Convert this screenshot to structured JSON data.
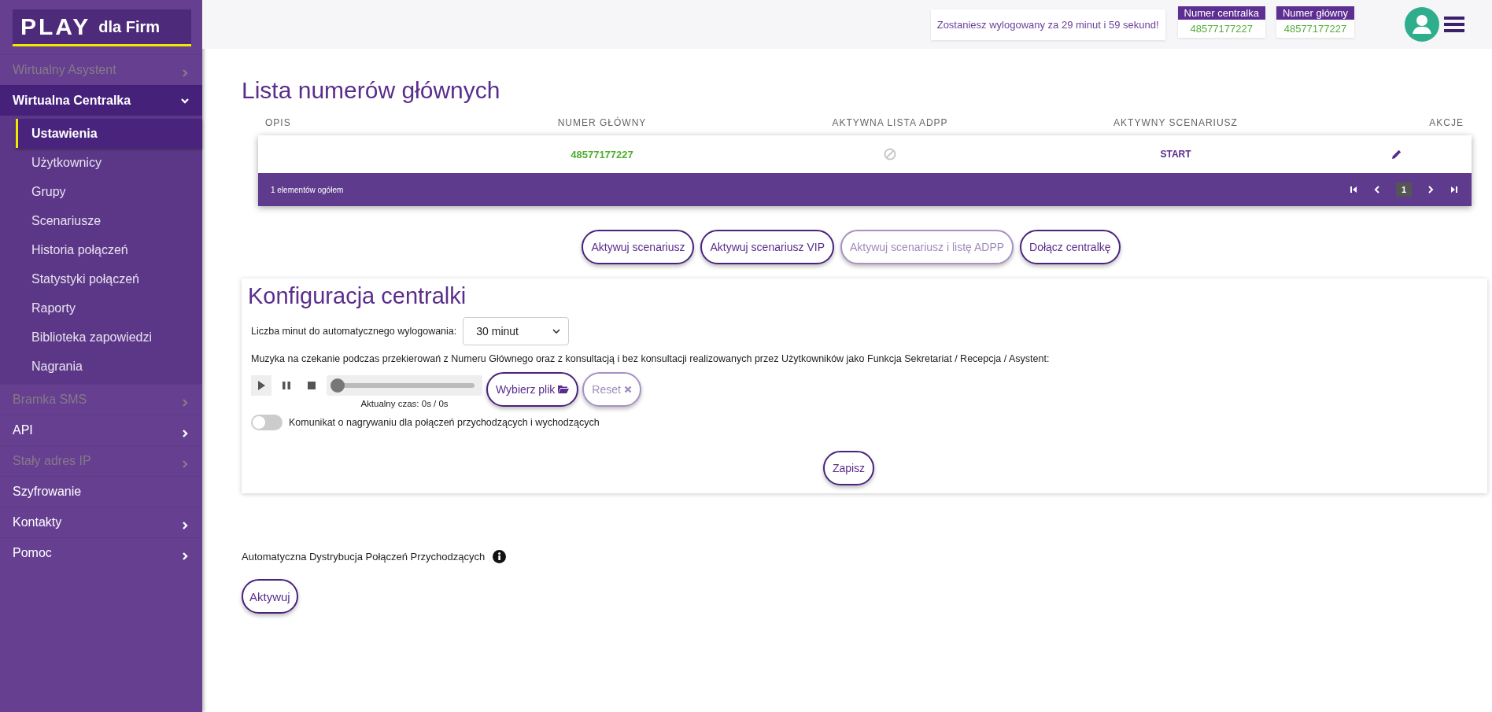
{
  "logo": {
    "brand": "PLAY",
    "suffix": "dla Firm"
  },
  "sidebar": {
    "items": [
      {
        "kind": "group",
        "label": "Wirtualny Asystent",
        "disabled": true,
        "expanded": false
      },
      {
        "kind": "group",
        "label": "Wirtualna Centralka",
        "disabled": false,
        "expanded": true,
        "children": [
          {
            "label": "Ustawienia",
            "selected": true
          },
          {
            "label": "Użytkownicy",
            "selected": false
          },
          {
            "label": "Grupy",
            "selected": false
          },
          {
            "label": "Scenariusze",
            "selected": false
          },
          {
            "label": "Historia połączeń",
            "selected": false
          },
          {
            "label": "Statystyki połączeń",
            "selected": false
          },
          {
            "label": "Raporty",
            "selected": false
          },
          {
            "label": "Biblioteka zapowiedzi",
            "selected": false
          },
          {
            "label": "Nagrania",
            "selected": false
          }
        ]
      },
      {
        "kind": "group",
        "label": "Bramka SMS",
        "disabled": true,
        "expanded": false
      },
      {
        "kind": "group",
        "label": "API",
        "disabled": false,
        "expanded": false
      },
      {
        "kind": "group",
        "label": "Stały adres IP",
        "disabled": true,
        "expanded": false
      },
      {
        "kind": "link",
        "label": "Szyfrowanie",
        "disabled": false
      },
      {
        "kind": "group",
        "label": "Kontakty",
        "disabled": false,
        "expanded": false
      },
      {
        "kind": "group",
        "label": "Pomoc",
        "disabled": false,
        "expanded": false
      }
    ]
  },
  "header": {
    "session_notice": "Zostaniesz wylogowany za 29 minut i 59 sekund!",
    "badges": [
      {
        "label": "Numer centralka",
        "value": "48577177227"
      },
      {
        "label": "Numer główny",
        "value": "48577177227"
      }
    ]
  },
  "table": {
    "title": "Lista numerów głównych",
    "columns": [
      "OPIS",
      "NUMER GŁÓWNY",
      "AKTYWNA LISTA ADPP",
      "AKTYWNY SCENARIUSZ",
      "AKCJE"
    ],
    "rows": [
      {
        "number": "48577177227",
        "adpp_active": false,
        "scenario": "START"
      }
    ],
    "footer": {
      "total": "1 elementów ogółem",
      "page": "1"
    }
  },
  "action_buttons": [
    {
      "label": "Aktywuj scenariusz",
      "disabled": false
    },
    {
      "label": "Aktywuj scenariusz VIP",
      "disabled": false
    },
    {
      "label": "Aktywuj scenariusz i listę ADPP",
      "disabled": true
    },
    {
      "label": "Dołącz centralkę",
      "disabled": false
    }
  ],
  "config": {
    "title": "Konfiguracja centralki",
    "logout_label": "Liczba minut do automatycznego wylogowania:",
    "logout_value": "30 minut",
    "music_label": "Muzyka na czekanie podczas przekierowań z Numeru Głównego oraz z konsultacją i bez konsultacji realizowanych przez Użytkowników jako Funkcja Sekretariat / Recepcja / Asystent:",
    "player": {
      "level": 0,
      "time": "Aktualny czas: 0s / 0s"
    },
    "choose_file": "Wybierz plik",
    "reset": {
      "label": "Reset",
      "disabled": true
    },
    "toggle": {
      "label": "Komunikat o nagrywaniu dla połączeń przychodzących i wychodzących",
      "on": false
    },
    "save": "Zapisz"
  },
  "acd": {
    "label": "Automatyczna Dystrybucja Połączeń Przychodzących",
    "button": "Aktywuj"
  }
}
